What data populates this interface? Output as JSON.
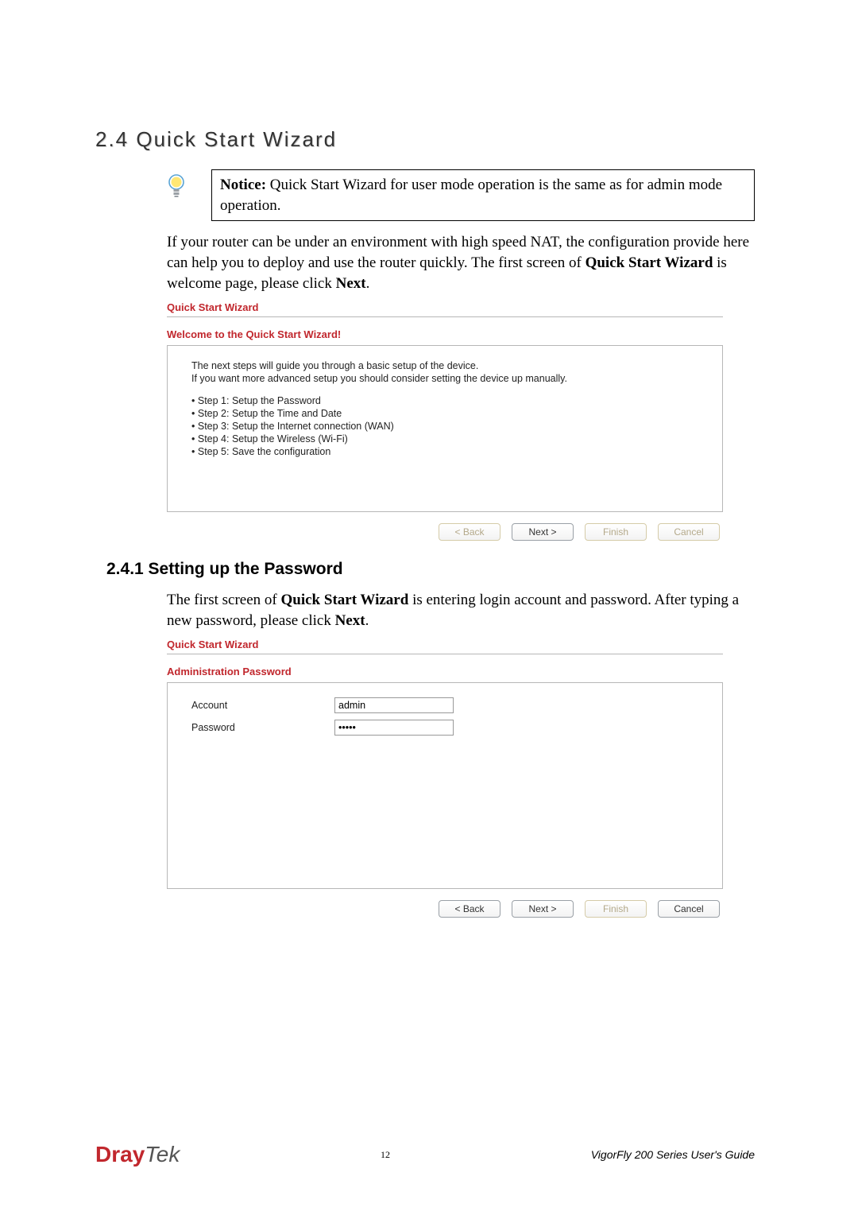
{
  "section": {
    "heading": "2.4 Quick Start Wizard",
    "notice_label": "Notice:",
    "notice_text": " Quick Start Wizard for user mode operation is the same as for admin mode operation.",
    "intro_part1": "If your router can be under an environment with high speed NAT, the configuration provide here can help you to deploy and use the router quickly. The first screen of ",
    "intro_bold": "Quick Start Wizard",
    "intro_part2": " is welcome page, please click ",
    "intro_bold2": "Next",
    "intro_part3": "."
  },
  "wizard1": {
    "title": "Quick Start Wizard",
    "subtitle": "Welcome to the Quick Start Wizard!",
    "line1": "The next steps will guide you through a basic setup of the device.",
    "line2": "If you want more advanced setup you should consider setting the device up manually.",
    "steps": [
      "Step 1: Setup the Password",
      "Step 2: Setup the Time and Date",
      "Step 3: Setup the Internet connection (WAN)",
      "Step 4: Setup the Wireless (Wi-Fi)",
      "Step 5: Save the configuration"
    ],
    "buttons": {
      "back": "< Back",
      "next": "Next >",
      "finish": "Finish",
      "cancel": "Cancel"
    }
  },
  "subsection": {
    "heading": "2.4.1 Setting up the Password",
    "body_part1": "The first screen of ",
    "body_bold1": "Quick Start Wizard",
    "body_part2": " is entering login account and password. After typing a new password, please click ",
    "body_bold2": "Next",
    "body_part3": "."
  },
  "wizard2": {
    "title": "Quick Start Wizard",
    "subtitle": "Administration Password",
    "account_label": "Account",
    "account_value": "admin",
    "password_label": "Password",
    "password_value": "•••••",
    "buttons": {
      "back": "< Back",
      "next": "Next >",
      "finish": "Finish",
      "cancel": "Cancel"
    }
  },
  "footer": {
    "logo_bold": "Dray",
    "logo_thin": "Tek",
    "page_number": "12",
    "guide": "VigorFly 200 Series User's Guide"
  }
}
